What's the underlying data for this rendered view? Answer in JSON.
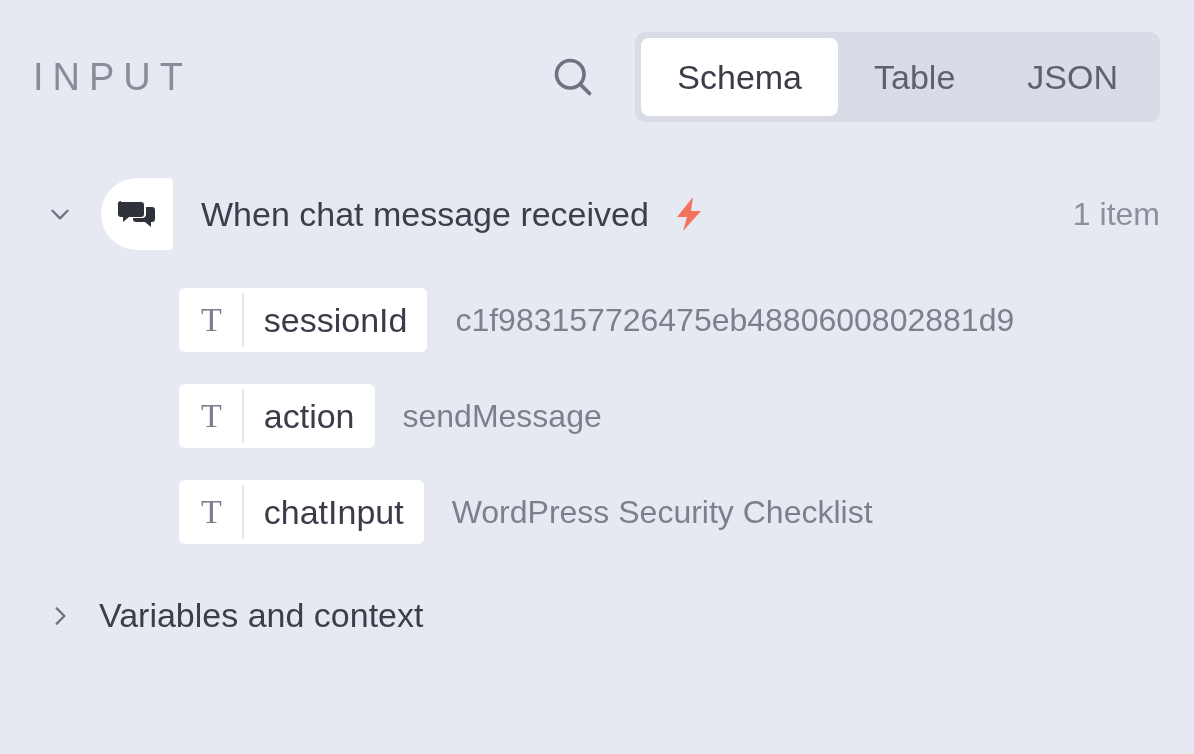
{
  "header": {
    "title": "INPUT",
    "view_tabs": [
      {
        "label": "Schema",
        "selected": true
      },
      {
        "label": "Table",
        "selected": false
      },
      {
        "label": "JSON",
        "selected": false
      }
    ]
  },
  "node": {
    "title": "When chat message received",
    "expanded": true,
    "count": "1 item",
    "fields": [
      {
        "type_glyph": "T",
        "name": "sessionId",
        "value": "c1f983157726475eb4880600802881d9"
      },
      {
        "type_glyph": "T",
        "name": "action",
        "value": "sendMessage"
      },
      {
        "type_glyph": "T",
        "name": "chatInput",
        "value": "WordPress Security Checklist"
      }
    ]
  },
  "sections": [
    {
      "title": "Variables and context",
      "expanded": false
    }
  ]
}
